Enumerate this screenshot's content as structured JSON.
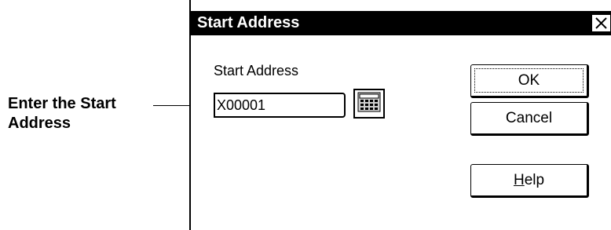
{
  "callout": {
    "line1": "Enter the Start",
    "line2": "Address"
  },
  "dialog": {
    "title": "Start Address",
    "close_icon": "close-icon",
    "field_label": "Start Address",
    "address_value": "X00001",
    "keypad_icon": "keypad-icon",
    "ok_label": "OK",
    "cancel_label": "Cancel",
    "help_mnemonic": "H",
    "help_rest": "elp"
  }
}
